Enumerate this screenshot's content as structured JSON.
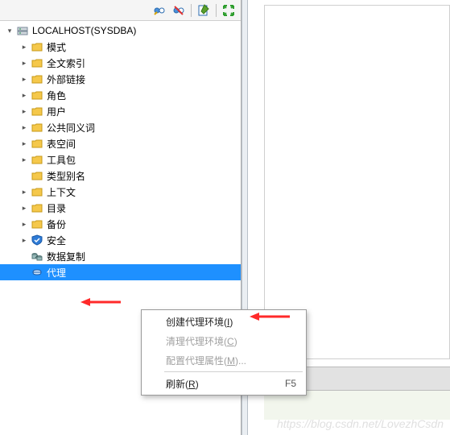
{
  "root": {
    "label": "LOCALHOST(SYSDBA)",
    "expanded": true
  },
  "nodes": [
    {
      "label": "模式",
      "icon": "folder",
      "exp": true
    },
    {
      "label": "全文索引",
      "icon": "folder",
      "exp": true
    },
    {
      "label": "外部链接",
      "icon": "folder",
      "exp": true
    },
    {
      "label": "角色",
      "icon": "folder",
      "exp": true
    },
    {
      "label": "用户",
      "icon": "folder",
      "exp": true
    },
    {
      "label": "公共同义词",
      "icon": "folder",
      "exp": true
    },
    {
      "label": "表空间",
      "icon": "folder",
      "exp": true
    },
    {
      "label": "工具包",
      "icon": "folder",
      "exp": true
    },
    {
      "label": "类型别名",
      "icon": "folder",
      "exp": false
    },
    {
      "label": "上下文",
      "icon": "folder",
      "exp": true
    },
    {
      "label": "目录",
      "icon": "folder",
      "exp": true
    },
    {
      "label": "备份",
      "icon": "folder",
      "exp": true
    },
    {
      "label": "安全",
      "icon": "shield",
      "exp": true
    },
    {
      "label": "数据复制",
      "icon": "replication",
      "exp": false
    },
    {
      "label": "代理",
      "icon": "agent",
      "exp": false,
      "selected": true
    }
  ],
  "menu": {
    "create": {
      "text": "创建代理环境",
      "accel": "I"
    },
    "clean": {
      "text": "清理代理环境",
      "accel": "C",
      "disabled": true
    },
    "config": {
      "text": "配置代理属性",
      "accel": "M",
      "suffix": "...",
      "disabled": true
    },
    "refresh": {
      "text": "刷新",
      "accel": "R",
      "shortcut": "F5"
    }
  },
  "watermark": "https://blog.csdn.net/LovezhCsdn"
}
